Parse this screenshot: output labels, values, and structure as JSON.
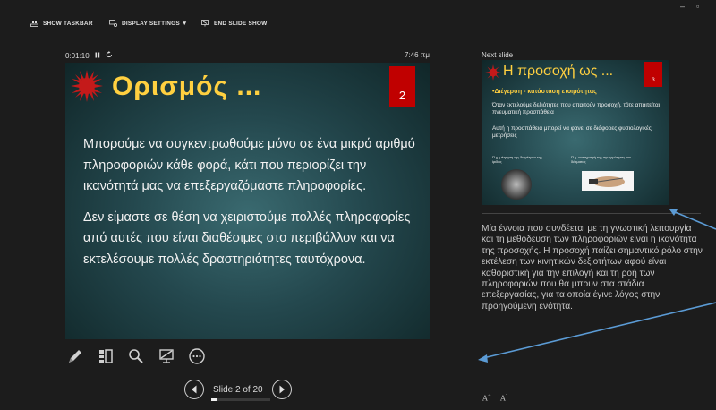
{
  "toolbar": {
    "show_taskbar": "SHOW TASKBAR",
    "display_settings": "DISPLAY SETTINGS ▼",
    "end_slide_show": "END SLIDE SHOW"
  },
  "window_controls": {
    "minimize": "–",
    "restore": "▫"
  },
  "presenter": {
    "elapsed_time": "0:01:10",
    "clock": "7:46 πμ",
    "next_slide_label": "Next slide"
  },
  "current_slide": {
    "title": "Ορισμός ...",
    "number": "2",
    "paragraphs": [
      "Μπορούμε να συγκεντρωθούμε μόνο σε ένα μικρό αριθμό πληροφοριών κάθε φορά, κάτι που περιορίζει την ικανότητά μας να επεξεργαζόμαστε πληροφορίες.",
      "Δεν είμαστε σε θέση να χειριστούμε πολλές πληροφορίες από  αυτές που είναι διαθέσιμες στο περιβάλλον και να εκτελέσουμε πολλές δραστηριότητες ταυτόχρονα."
    ]
  },
  "next_slide": {
    "title": "Η προσοχή ως ...",
    "number": "3",
    "subtitle": "•Διέγερση -  κατάσταση ετοιμότητας",
    "paragraph1": "Όταν εκτελούμε δεξιότητες που απαιτούν προσοχή, τότε απαιτείται πνευματική προσπάθεια",
    "paragraph2": "Αυτή η προσπάθεια μπορεί να φανεί σε διάφορες φυσιολογικές μετρήσεις",
    "caption1": "Π.χ. μέτρηση της διαμέτρου της ίριδας",
    "caption2": "Π.χ. καταγραφή της αγωγιμότητας του δέρματος"
  },
  "navigation": {
    "slide_indicator": "Slide 2 of 20",
    "progress": 0.1
  },
  "notes": {
    "text": "Μία έννοια που συνδέεται με τη γνωστική λειτουργία και τη μεθόδευση των πληροφοριών είναι η ικανότητα της προσοχής. Η προσοχή παίζει σημαντικό ρόλο στην εκτέλεση των κινητικών δεξιοτήτων αφού είναι καθοριστική για την επιλογή και τη ροή των πληροφοριών που θα μπουν στα στάδια επεξεργασίας, για τα οποία έγινε λόγος στην προηγούμενη ενότητα."
  },
  "font_controls": {
    "increase": "A",
    "decrease": "A"
  },
  "colors": {
    "title_yellow": "#ffd040",
    "number_red": "#c00000",
    "slide_teal": "#24484e",
    "annotation_arrow": "#5b9bd5"
  }
}
